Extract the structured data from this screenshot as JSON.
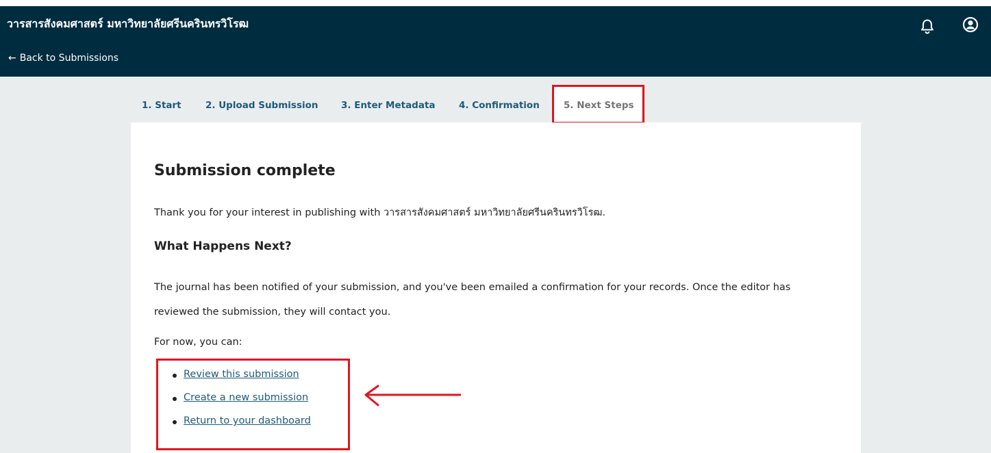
{
  "header": {
    "journal_title": "วารสารสังคมศาสตร์ มหาวิทยาลัยศรีนครินทรวิโรฒ",
    "back_arrow": "←",
    "back_label": "Back to Submissions",
    "bell_icon": "bell-icon",
    "user_icon": "user-icon",
    "background_color": "#002c40"
  },
  "steps": [
    {
      "label": "1. Start"
    },
    {
      "label": "2. Upload Submission"
    },
    {
      "label": "3. Enter Metadata"
    },
    {
      "label": "4. Confirmation"
    },
    {
      "label": "5. Next Steps",
      "active": true
    }
  ],
  "content": {
    "title": "Submission complete",
    "thank_you": "Thank you for your interest in publishing with วารสารสังคมศาสตร์ มหาวิทยาลัยศรีนครินทรวิโรฒ.",
    "next_heading": "What Happens Next?",
    "notified": "The journal has been notified of your submission, and you've been emailed a confirmation for your records. Once the editor has reviewed the submission, they will contact you.",
    "for_now": "For now, you can:",
    "actions": [
      {
        "label": "Review this submission"
      },
      {
        "label": "Create a new submission"
      },
      {
        "label": "Return to your dashboard"
      }
    ]
  },
  "colors": {
    "link": "#1e5a7a",
    "annotation_red": "#e0151e",
    "workspace_bg": "#eaedee"
  }
}
